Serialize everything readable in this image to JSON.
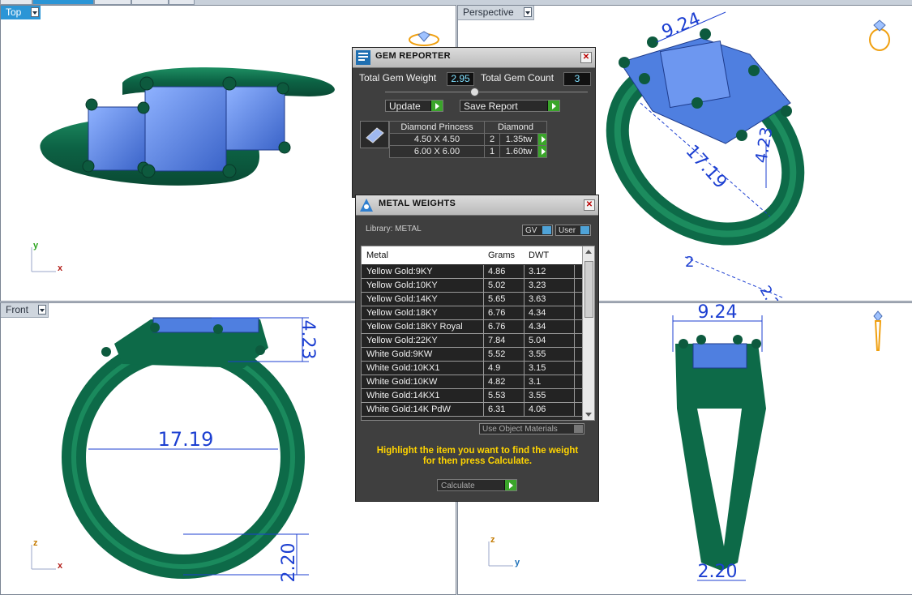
{
  "viewports": {
    "top": {
      "label": "Top",
      "axis_a": "y",
      "axis_b": "x"
    },
    "perspective": {
      "label": "Perspective",
      "dims": [
        "9.24",
        "17.19",
        "4.23",
        "2",
        "2.20"
      ]
    },
    "front": {
      "label": "Front",
      "axis_a": "z",
      "axis_b": "x",
      "dims": {
        "d1": "4.23",
        "d2": "17.19",
        "d3": "2.20"
      }
    },
    "right": {
      "axis_a": "z",
      "axis_b": "y",
      "dims": {
        "d1": "9.24",
        "d2": "2.20"
      }
    }
  },
  "gem_reporter": {
    "title": "GEM REPORTER",
    "total_weight_label": "Total Gem Weight",
    "total_weight_value": "2.95",
    "total_count_label": "Total Gem Count",
    "total_count_value": "3",
    "update_label": "Update",
    "save_report_label": "Save Report",
    "gem_name": "Diamond Princess",
    "gem_material": "Diamond",
    "rows": [
      {
        "size": "4.50 X 4.50",
        "count": "2",
        "weight": "1.35tw"
      },
      {
        "size": "6.00 X 6.00",
        "count": "1",
        "weight": "1.60tw"
      }
    ]
  },
  "metal_weights": {
    "title": "METAL WEIGHTS",
    "library_label": "Library: METAL",
    "toggle_gv": "GV",
    "toggle_user": "User",
    "columns": [
      "Metal",
      "Grams",
      "DWT"
    ],
    "rows": [
      {
        "metal": "Yellow Gold:9KY",
        "grams": "4.86",
        "dwt": "3.12"
      },
      {
        "metal": "Yellow Gold:10KY",
        "grams": "5.02",
        "dwt": "3.23"
      },
      {
        "metal": "Yellow Gold:14KY",
        "grams": "5.65",
        "dwt": "3.63"
      },
      {
        "metal": "Yellow Gold:18KY",
        "grams": "6.76",
        "dwt": "4.34"
      },
      {
        "metal": "Yellow Gold:18KY Royal",
        "grams": "6.76",
        "dwt": "4.34"
      },
      {
        "metal": "Yellow Gold:22KY",
        "grams": "7.84",
        "dwt": "5.04"
      },
      {
        "metal": "White Gold:9KW",
        "grams": "5.52",
        "dwt": "3.55"
      },
      {
        "metal": "White Gold:10KX1",
        "grams": "4.9",
        "dwt": "3.15"
      },
      {
        "metal": "White Gold:10KW",
        "grams": "4.82",
        "dwt": "3.1"
      },
      {
        "metal": "White Gold:14KX1",
        "grams": "5.53",
        "dwt": "3.55"
      },
      {
        "metal": "White Gold:14K PdW",
        "grams": "6.31",
        "dwt": "4.06"
      }
    ],
    "use_object_materials_label": "Use Object Materials",
    "hint": "Highlight the item you want to find the weight for then press Calculate.",
    "calculate_label": "Calculate"
  },
  "colors": {
    "ring": "#0f6e4c",
    "gem": "#4f7fe0",
    "dimension": "#1c3fd1",
    "viewport_active": "#2b95d6"
  }
}
